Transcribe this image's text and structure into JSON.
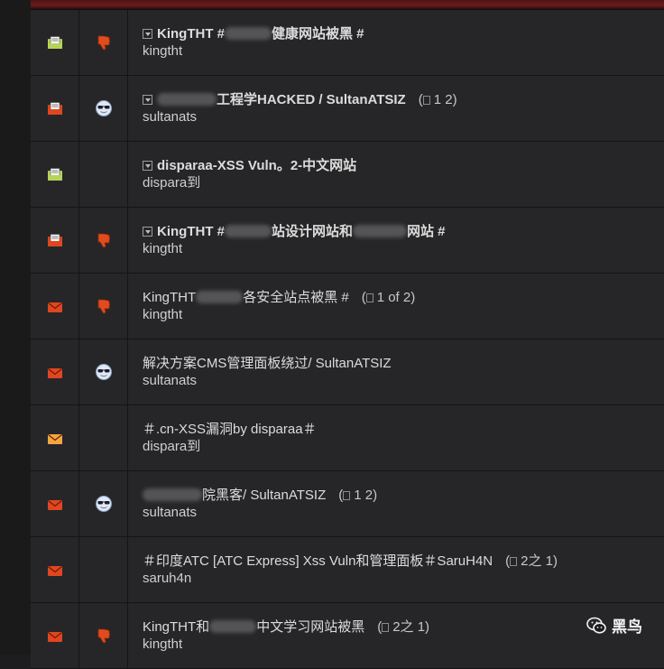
{
  "rows": [
    {
      "status": "read-hot",
      "icon": "thumbs-down",
      "pre": "KingTHT #",
      "post": "健康网站被黑 #",
      "blur": 1,
      "pages": "",
      "author": "kingtht",
      "bold": true,
      "expander": true
    },
    {
      "status": "unread-hot",
      "icon": "sunglasses",
      "pre": "",
      "post": "工程学HACKED / SultanATSIZ",
      "blur": 1,
      "pages": "1 2)",
      "author": "sultanats",
      "bold": true,
      "expander": true
    },
    {
      "status": "read-hot",
      "icon": "none",
      "pre": "disparaa-XSS Vuln。2-中文网站",
      "post": "",
      "blur": 0,
      "pages": "",
      "author": "dispara到",
      "bold": true,
      "expander": true
    },
    {
      "status": "unread-hot",
      "icon": "thumbs-down",
      "pre": "KingTHT #",
      "post": "站设计网站和",
      "post2": "网站 #",
      "blur": 2,
      "pages": "",
      "author": "kingtht",
      "bold": true,
      "expander": true
    },
    {
      "status": "unread",
      "icon": "thumbs-down",
      "pre": "KingTHT",
      "post": "各安全站点被黑 #",
      "blur": 1,
      "pages": "1 of 2)",
      "author": "kingtht",
      "bold": false,
      "expander": false
    },
    {
      "status": "unread",
      "icon": "sunglasses",
      "pre": "解决方案CMS管理面板绕过/ SultanATSIZ",
      "post": "",
      "blur": 0,
      "pages": "",
      "author": "sultanats",
      "bold": false,
      "expander": false
    },
    {
      "status": "read",
      "icon": "none",
      "pre": "＃.cn-XSS漏洞by disparaa＃",
      "post": "",
      "blur": 0,
      "pages": "",
      "author": "dispara到",
      "bold": false,
      "expander": false
    },
    {
      "status": "unread",
      "icon": "sunglasses",
      "pre": "",
      "post": "院黑客/ SultanATSIZ",
      "blur": 1,
      "pages": "1 2)",
      "author": "sultanats",
      "bold": false,
      "expander": false
    },
    {
      "status": "unread",
      "icon": "none",
      "pre": "＃印度ATC [ATC Express] Xss Vuln和管理面板＃SaruH4N",
      "post": "",
      "blur": 0,
      "pages": "2之 1)",
      "author": "saruh4n",
      "bold": false,
      "expander": false
    },
    {
      "status": "unread",
      "icon": "thumbs-down",
      "pre": "KingTHT和",
      "post": "中文学习网站被黑",
      "blur": 1,
      "pages": "2之 1)",
      "author": "kingtht",
      "bold": false,
      "expander": false
    }
  ],
  "watermark": {
    "text": "黑鸟",
    "icon": "wechat-icon"
  },
  "colors": {
    "envelope_red": "#e0461f",
    "envelope_green": "#b6d45a",
    "envelope_orange": "#f2a640",
    "row_bg": "#262628"
  }
}
